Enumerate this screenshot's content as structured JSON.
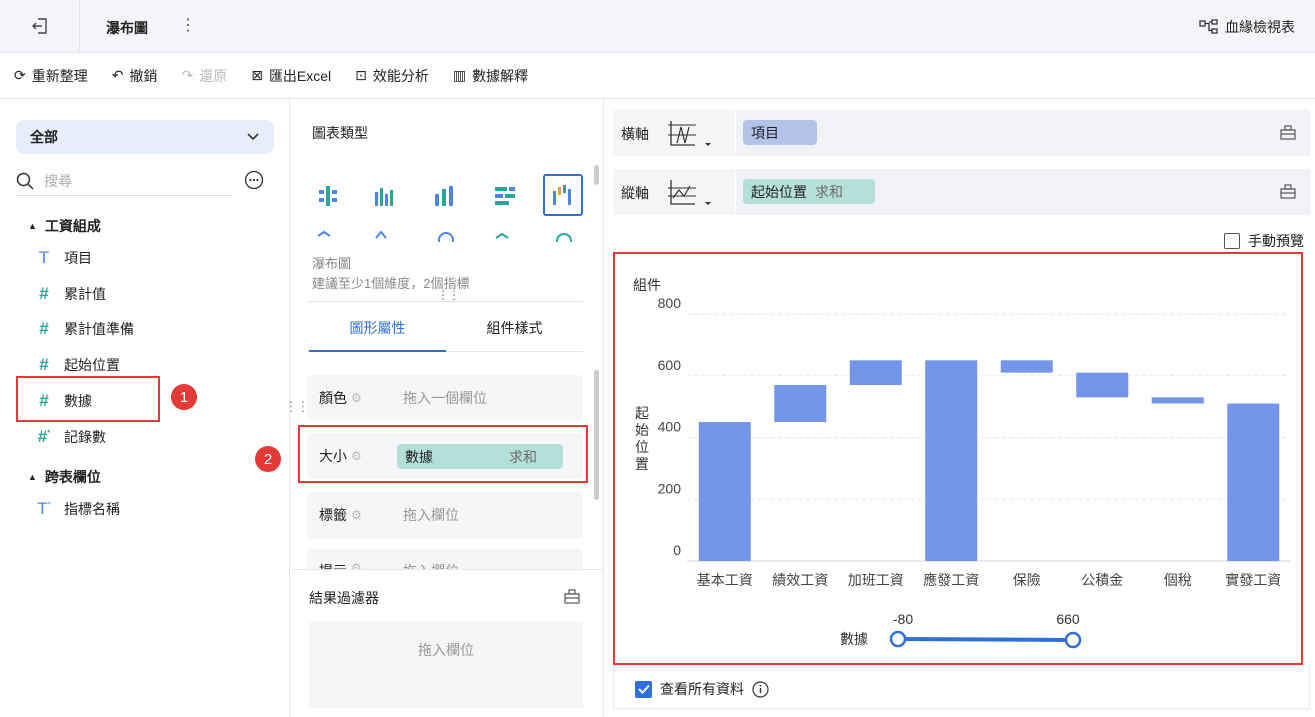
{
  "header": {
    "title": "瀑布圖",
    "lineage_label": "血緣檢視表"
  },
  "toolbar": {
    "refresh": "重新整理",
    "undo": "撤銷",
    "redo": "還原",
    "export": "匯出Excel",
    "perf": "效能分析",
    "explain": "數據解釋"
  },
  "left_panel": {
    "dataset_select": "全部",
    "search_placeholder": "搜尋",
    "groups": [
      {
        "name": "工資組成",
        "fields": [
          {
            "label": "項目",
            "kind": "text"
          },
          {
            "label": "累計值",
            "kind": "number"
          },
          {
            "label": "累計值準備",
            "kind": "number"
          },
          {
            "label": "起始位置",
            "kind": "number"
          },
          {
            "label": "數據",
            "kind": "number"
          },
          {
            "label": "記錄數",
            "kind": "number-calc"
          }
        ]
      },
      {
        "name": "跨表欄位",
        "fields": [
          {
            "label": "指標名稱",
            "kind": "text-calc"
          }
        ]
      }
    ]
  },
  "annotations": {
    "badge1": "1",
    "badge2": "2"
  },
  "middle_panel": {
    "chart_type_title": "圖表類型",
    "selected_type_name": "瀑布圖",
    "hint": "建議至少1個維度，2個指標",
    "tabs": [
      "圖形屬性",
      "組件樣式"
    ],
    "properties": [
      {
        "name": "顏色",
        "placeholder": "拖入一個欄位"
      },
      {
        "name": "大小",
        "value_field": "數據",
        "value_agg": "求和"
      },
      {
        "name": "標籤",
        "placeholder": "拖入欄位"
      },
      {
        "name": "提示",
        "placeholder": "拖入欄位"
      }
    ],
    "filter_title": "結果過濾器",
    "filter_placeholder": "拖入欄位"
  },
  "right_panel": {
    "x_axis_label": "橫軸",
    "x_field": "項目",
    "y_axis_label": "縱軸",
    "y_field": "起始位置",
    "y_agg": "求和",
    "manual_preview": "手動預覽",
    "view_all_data": "查看所有資料"
  },
  "colors": {
    "accent": "#2f6fdc",
    "bar": "#7396ea",
    "red": "#e53935",
    "pill_dim": "#b3c3ea",
    "pill_measure": "#b5e0da"
  },
  "chart_data": {
    "type": "waterfall",
    "title": "組件",
    "ylabel": "起始位置",
    "ylim": [
      0,
      800
    ],
    "yticks": [
      0,
      200,
      400,
      600,
      800
    ],
    "categories": [
      "基本工資",
      "績效工資",
      "加班工資",
      "應發工資",
      "保險",
      "公積金",
      "個稅",
      "實發工資"
    ],
    "bars": [
      {
        "start": 0,
        "end": 450
      },
      {
        "start": 450,
        "end": 570
      },
      {
        "start": 570,
        "end": 650
      },
      {
        "start": 0,
        "end": 650
      },
      {
        "start": 610,
        "end": 650
      },
      {
        "start": 530,
        "end": 610
      },
      {
        "start": 510,
        "end": 530
      },
      {
        "start": 0,
        "end": 510
      }
    ],
    "size_legend": {
      "label": "數據",
      "min": "-80",
      "max": "660"
    }
  }
}
